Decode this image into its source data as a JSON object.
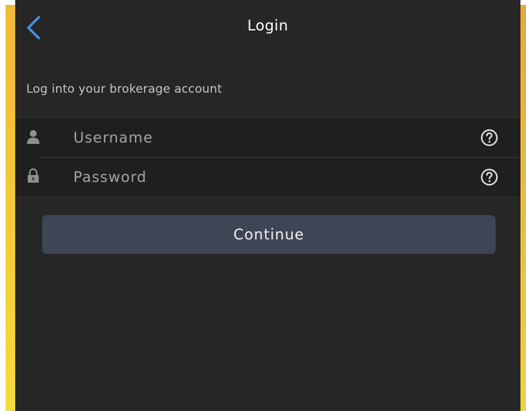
{
  "navbar": {
    "title": "Login",
    "back_icon": "chevron-left-icon"
  },
  "form": {
    "subtitle": "Log into your brokerage account",
    "username": {
      "placeholder": "Username",
      "value": "",
      "icon": "person-icon",
      "help_icon": "question-circle-icon"
    },
    "password": {
      "placeholder": "Password",
      "value": "",
      "icon": "lock-icon",
      "help_icon": "question-circle-icon"
    },
    "continue_label": "Continue"
  },
  "colors": {
    "background": "#262626",
    "field_background": "#1f1f1f",
    "accent_blue": "#4a90e2",
    "button_background": "#3e4655",
    "frame_yellow": "#f4cc38"
  }
}
